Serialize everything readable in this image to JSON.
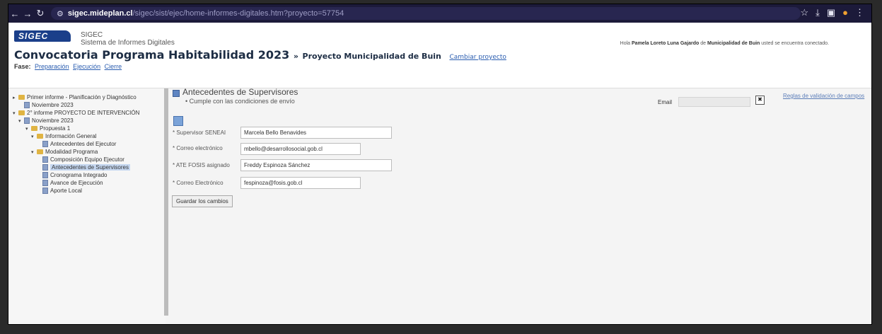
{
  "browser": {
    "url_host": "sigec.mideplan.cl",
    "url_path": "/sigec/sist/ejec/home-informes-digitales.htm?proyecto=57754"
  },
  "header": {
    "logo_text": "SIGEC",
    "app_name": "SIGEC",
    "app_subtitle": "Sistema de Informes Digitales",
    "title_main": "Convocatoria Programa Habitabilidad 2023",
    "title_separator": "»",
    "title_project": "Proyecto Municipalidad de Buin",
    "change_project_link": "Cambiar proyecto",
    "user_greeting": "Hola",
    "user_name": "Pamela Loreto Luna Gajardo",
    "user_of": "de",
    "user_org": "Municipalidad de Buin",
    "user_status": "usted se encuentra conectado.",
    "fase_label": "Fase:",
    "fase_links": [
      "Preparación",
      "Ejecución",
      "Cierre"
    ]
  },
  "tree": {
    "nodes": [
      "Primer informe - Planificación y Diagnóstico",
      "Noviembre 2023",
      "2° informe PROYECTO DE INTERVENCIÓN",
      "Noviembre 2023",
      "Propuesta 1",
      "Información General",
      "Antecedentes del Ejecutor",
      "Modalidad Programa",
      "Composición Equipo Ejecutor",
      "Antecedentes de Supervisores",
      "Cronograma Integrado",
      "Avance de Ejecución",
      "Aporte Local"
    ]
  },
  "panel": {
    "title": "Antecedentes de Supervisores",
    "note": "Cumple con las condiciones de envío",
    "report_label": "Email",
    "close_symbol": "✖",
    "validation_link": "Reglas de validación de campos"
  },
  "form": {
    "fields": [
      {
        "label": "Supervisor SENEAI",
        "value": "Marcela Bello Benavides"
      },
      {
        "label": "Correo electrónico",
        "value": "mbello@desarrollosocial.gob.cl"
      },
      {
        "label": "ATE FOSIS asignado",
        "value": "Freddy Espinoza Sánchez"
      },
      {
        "label": "Correo Electrónico",
        "value": "fespinoza@fosis.gob.cl"
      }
    ],
    "save_label": "Guardar los cambios"
  },
  "colors": {
    "browser_bar": "#1c1a3a",
    "title": "#1d2d44",
    "link": "#2a5db0",
    "logo": "#1b3f8a"
  },
  "icons": [
    "back-icon",
    "forward-icon",
    "reload-icon",
    "star-icon",
    "download-icon",
    "extension-icon",
    "profile-icon",
    "menu-icon",
    "folder-icon",
    "document-icon",
    "save-icon",
    "close-icon"
  ]
}
